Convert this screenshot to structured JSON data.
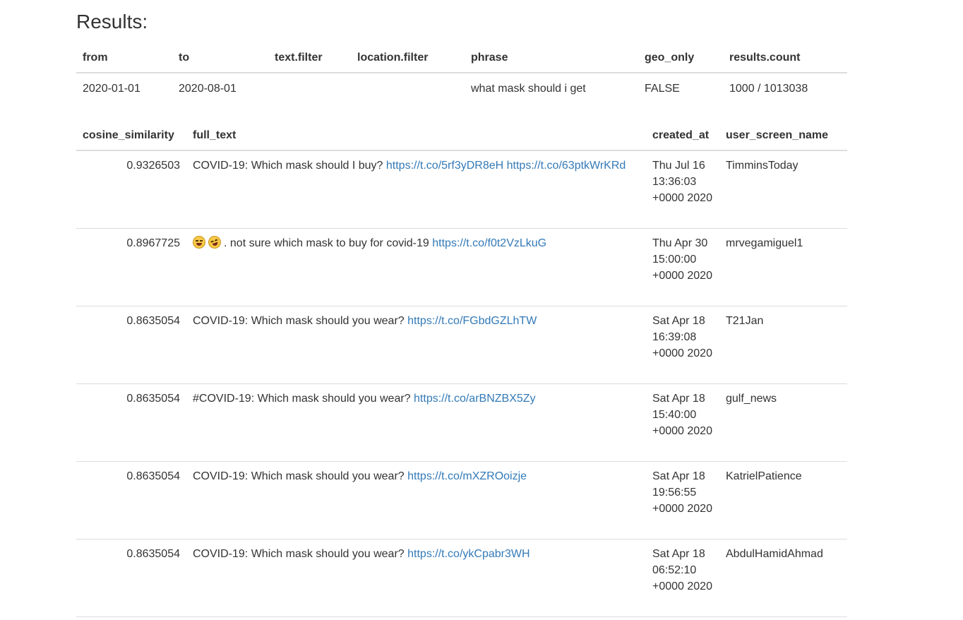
{
  "title": "Results:",
  "params": {
    "headers": [
      "from",
      "to",
      "text.filter",
      "location.filter",
      "phrase",
      "geo_only",
      "results.count"
    ],
    "values": [
      "2020-01-01",
      "2020-08-01",
      "",
      "",
      "what mask should i get",
      "FALSE",
      "1000 / 1013038"
    ]
  },
  "results": {
    "headers": [
      "cosine_similarity",
      "full_text",
      "created_at",
      "user_screen_name"
    ],
    "rows": [
      {
        "cosine_similarity": "0.9326503",
        "text": "COVID-19: Which mask should I buy?",
        "links": [
          "https://t.co/5rf3yDR8eH",
          "https://t.co/63ptkWrKRd"
        ],
        "emojis": [],
        "created_at": "Thu Jul 16 13:36:03 +0000 2020",
        "user_screen_name": "TimminsToday"
      },
      {
        "cosine_similarity": "0.8967725",
        "text": ". not sure which mask to buy for covid-19",
        "links": [
          "https://t.co/f0t2VzLkuG"
        ],
        "emojis": [
          "face-with-tears-of-joy-icon",
          "rolling-on-floor-laughing-icon"
        ],
        "created_at": "Thu Apr 30 15:00:00 +0000 2020",
        "user_screen_name": "mrvegamiguel1"
      },
      {
        "cosine_similarity": "0.8635054",
        "text": "COVID-19: Which mask should you wear?",
        "links": [
          "https://t.co/FGbdGZLhTW"
        ],
        "emojis": [],
        "created_at": "Sat Apr 18 16:39:08 +0000 2020",
        "user_screen_name": "T21Jan"
      },
      {
        "cosine_similarity": "0.8635054",
        "text": "#COVID-19: Which mask should you wear?",
        "links": [
          "https://t.co/arBNZBX5Zy"
        ],
        "emojis": [],
        "created_at": "Sat Apr 18 15:40:00 +0000 2020",
        "user_screen_name": "gulf_news"
      },
      {
        "cosine_similarity": "0.8635054",
        "text": "COVID-19: Which mask should you wear?",
        "links": [
          "https://t.co/mXZROoizje"
        ],
        "emojis": [],
        "created_at": "Sat Apr 18 19:56:55 +0000 2020",
        "user_screen_name": "KatrielPatience"
      },
      {
        "cosine_similarity": "0.8635054",
        "text": "COVID-19: Which mask should you wear?",
        "links": [
          "https://t.co/ykCpabr3WH"
        ],
        "emojis": [],
        "created_at": "Sat Apr 18 06:52:10 +0000 2020",
        "user_screen_name": "AbdulHamidAhmad"
      }
    ]
  },
  "colors": {
    "text": "#333333",
    "link": "#337ab7",
    "border": "#dddddd"
  }
}
